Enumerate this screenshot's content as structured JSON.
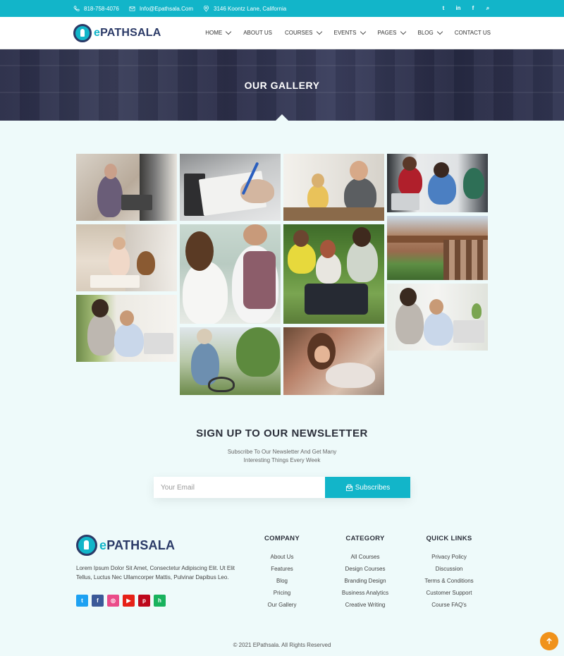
{
  "topbar": {
    "phone": "818-758-4076",
    "email": "Info@Epathsala.Com",
    "address": "3146 Koontz Lane, California"
  },
  "brand": {
    "prefix": "e",
    "name": "PATHSALA"
  },
  "nav": [
    {
      "label": "HOME",
      "has_dropdown": true
    },
    {
      "label": "ABOUT US",
      "has_dropdown": false
    },
    {
      "label": "COURSES",
      "has_dropdown": true
    },
    {
      "label": "EVENTS",
      "has_dropdown": true
    },
    {
      "label": "PAGES",
      "has_dropdown": true
    },
    {
      "label": "BLOG",
      "has_dropdown": true
    },
    {
      "label": "CONTACT US",
      "has_dropdown": false
    }
  ],
  "hero": {
    "title": "OUR GALLERY"
  },
  "newsletter": {
    "title": "SIGN UP TO OUR NEWSLETTER",
    "subtitle_line1": "Subscribe To Our Newsletter And Get Many",
    "subtitle_line2": "Interesting Things Every Week",
    "email_placeholder": "Your Email",
    "button_label": "Subscribes"
  },
  "footer": {
    "description": "Lorem Ipsum Dolor Sit Amet, Consectetur Adipiscing Elit. Ut Elit Tellus, Luctus Nec Ullamcorper Mattis, Pulvinar Dapibus Leo.",
    "columns": [
      {
        "title": "COMPANY",
        "links": [
          "About Us",
          "Features",
          "Blog",
          "Pricing",
          "Our Gallery"
        ]
      },
      {
        "title": "CATEGORY",
        "links": [
          "All Courses",
          "Design Courses",
          "Branding Design",
          "Business Analytics",
          "Creative Writing"
        ]
      },
      {
        "title": "QUICK LINKS",
        "links": [
          "Privacy Policy",
          "Discussion",
          "Terms & Conditions",
          "Customer Support",
          "Course FAQ's"
        ]
      }
    ],
    "social": [
      {
        "icon": "twitter-icon",
        "glyph": "t",
        "color": "#1da1f2"
      },
      {
        "icon": "facebook-icon",
        "glyph": "f",
        "color": "#3b5998"
      },
      {
        "icon": "dribbble-icon",
        "glyph": "◎",
        "color": "#ea4c89"
      },
      {
        "icon": "youtube-icon",
        "glyph": "▶",
        "color": "#e62117"
      },
      {
        "icon": "pinterest-icon",
        "glyph": "p",
        "color": "#bd081c"
      },
      {
        "icon": "houzz-icon",
        "glyph": "h",
        "color": "#18b25d"
      }
    ],
    "copyright": "© 2021 EPathsala. All Rights Reserved"
  },
  "colors": {
    "accent": "#12b5c9",
    "brand_dark": "#2b3a67",
    "to_top": "#f0921b"
  }
}
